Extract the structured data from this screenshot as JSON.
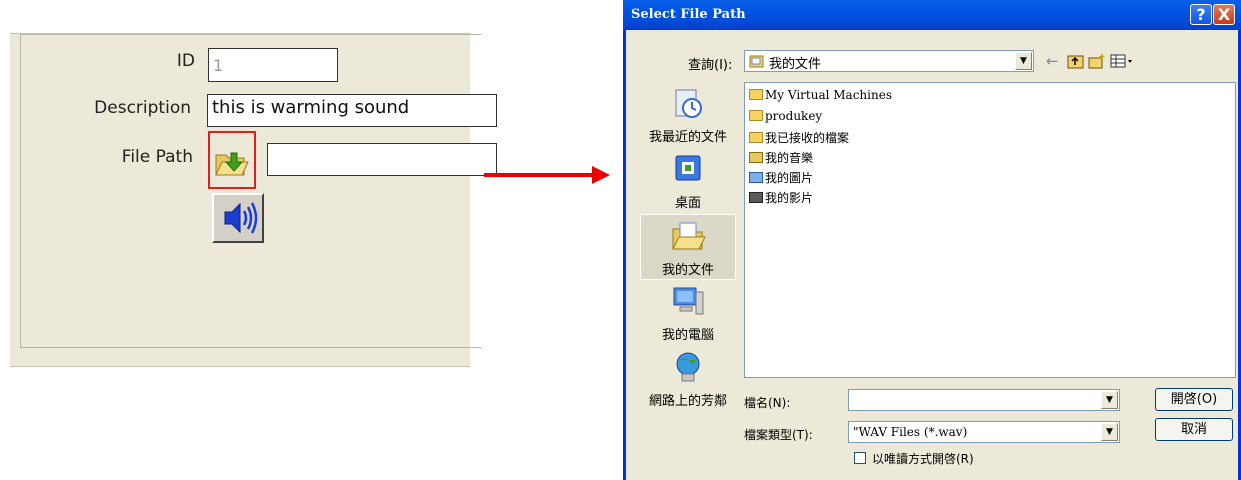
{
  "form": {
    "id_label": "ID",
    "id_value": "1",
    "description_label": "Description",
    "description_value": "this is warming sound",
    "file_path_label": "File Path",
    "file_path_value": ""
  },
  "dialog": {
    "title": "Select File Path",
    "help_glyph": "?",
    "close_glyph": "X",
    "look_in_label": "查詢(I):",
    "look_in_value": "我的文件",
    "places": [
      {
        "label": "我最近的文件",
        "icon": "recent-documents-icon"
      },
      {
        "label": "桌面",
        "icon": "desktop-icon"
      },
      {
        "label": "我的文件",
        "icon": "my-documents-icon"
      },
      {
        "label": "我的電腦",
        "icon": "my-computer-icon"
      },
      {
        "label": "網路上的芳鄰",
        "icon": "network-places-icon"
      }
    ],
    "files": [
      {
        "name": "My Virtual Machines",
        "icon": "folder-icon"
      },
      {
        "name": "produkey",
        "icon": "folder-icon"
      },
      {
        "name": "我已接收的檔案",
        "icon": "folder-icon"
      },
      {
        "name": "我的音樂",
        "icon": "music-folder-icon"
      },
      {
        "name": "我的圖片",
        "icon": "pictures-folder-icon"
      },
      {
        "name": "我的影片",
        "icon": "video-folder-icon"
      }
    ],
    "file_name_label": "檔名(N):",
    "file_name_value": "",
    "file_type_label": "檔案類型(T):",
    "file_type_value": "\"WAV Files (*.wav)",
    "read_only_label": "以唯讀方式開啓(R)",
    "open_button": "開啓(O)",
    "cancel_button": "取消"
  },
  "colors": {
    "highlight": "#e02020",
    "arrow": "#ee0000",
    "xp_titlebar": "#0054e3",
    "dialog_bg": "#ece9d8"
  }
}
